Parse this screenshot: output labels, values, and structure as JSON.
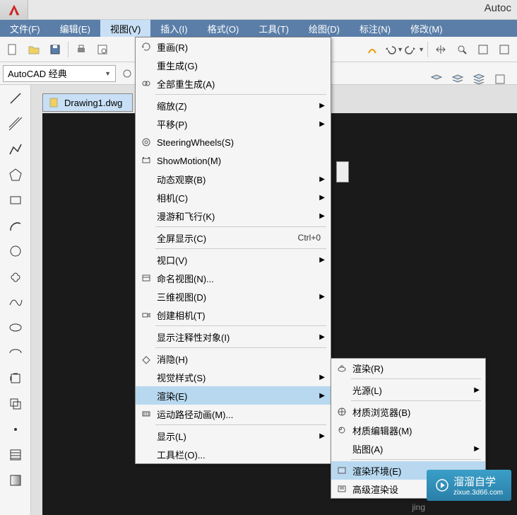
{
  "app": {
    "title_fragment": "Autoc"
  },
  "menubar": {
    "items": [
      {
        "label": "文件(F)"
      },
      {
        "label": "编辑(E)"
      },
      {
        "label": "视图(V)",
        "active": true
      },
      {
        "label": "插入(I)"
      },
      {
        "label": "格式(O)"
      },
      {
        "label": "工具(T)"
      },
      {
        "label": "绘图(D)"
      },
      {
        "label": "标注(N)"
      },
      {
        "label": "修改(M)"
      }
    ]
  },
  "workspace": {
    "label": "AutoCAD 经典"
  },
  "drawing": {
    "filename": "Drawing1.dwg"
  },
  "view_menu": {
    "items": [
      {
        "label": "重画(R)",
        "icon": "redraw"
      },
      {
        "label": "重生成(G)"
      },
      {
        "label": "全部重生成(A)",
        "icon": "regen-all"
      },
      {
        "sep": true
      },
      {
        "label": "缩放(Z)",
        "submenu": true
      },
      {
        "label": "平移(P)",
        "submenu": true
      },
      {
        "label": "SteeringWheels(S)",
        "icon": "wheel"
      },
      {
        "label": "ShowMotion(M)",
        "icon": "film"
      },
      {
        "label": "动态观察(B)",
        "submenu": true
      },
      {
        "label": "相机(C)",
        "submenu": true
      },
      {
        "label": "漫游和飞行(K)",
        "submenu": true
      },
      {
        "sep": true
      },
      {
        "label": "全屏显示(C)",
        "shortcut": "Ctrl+0"
      },
      {
        "sep": true
      },
      {
        "label": "视口(V)",
        "submenu": true
      },
      {
        "label": "命名视图(N)...",
        "icon": "named-view"
      },
      {
        "label": "三维视图(D)",
        "submenu": true
      },
      {
        "label": "创建相机(T)",
        "icon": "camera"
      },
      {
        "sep": true
      },
      {
        "label": "显示注释性对象(I)",
        "submenu": true
      },
      {
        "sep": true
      },
      {
        "label": "消隐(H)",
        "icon": "hide"
      },
      {
        "label": "视觉样式(S)",
        "submenu": true
      },
      {
        "label": "渲染(E)",
        "submenu": true,
        "highlighted": true
      },
      {
        "label": "运动路径动画(M)...",
        "icon": "motion-path"
      },
      {
        "sep": true
      },
      {
        "label": "显示(L)",
        "submenu": true
      },
      {
        "label": "工具栏(O)..."
      }
    ]
  },
  "render_submenu": {
    "items": [
      {
        "label": "渲染(R)",
        "icon": "teapot"
      },
      {
        "sep": true
      },
      {
        "label": "光源(L)",
        "submenu": true
      },
      {
        "sep": true
      },
      {
        "label": "材质浏览器(B)",
        "icon": "mat-browser"
      },
      {
        "label": "材质编辑器(M)",
        "icon": "mat-editor"
      },
      {
        "label": "贴图(A)",
        "submenu": true
      },
      {
        "sep": true
      },
      {
        "label": "渲染环境(E)",
        "icon": "render-env",
        "highlighted": true
      },
      {
        "label": "高级渲染设",
        "icon": "adv-render"
      }
    ]
  },
  "watermark": {
    "brand": "溜溜自学",
    "site": "zixue.3d66.com"
  },
  "misc": {
    "jing": "jing"
  }
}
